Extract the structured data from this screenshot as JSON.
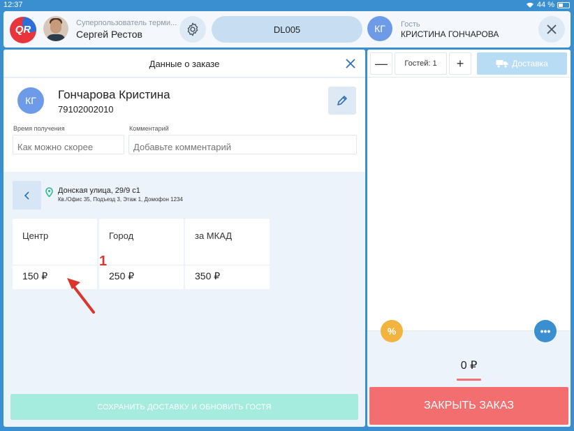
{
  "status_bar": {
    "time": "12:37",
    "battery": "44 %"
  },
  "header": {
    "logo_text": "QR",
    "user_role": "Суперпользователь терми...",
    "user_name": "Сергей Рестов",
    "order_code": "DL005",
    "guest_initials": "КГ",
    "guest_role": "Гость",
    "guest_name": "КРИСТИНА ГОНЧАРОВА"
  },
  "order_panel": {
    "title": "Данные о заказе",
    "customer": {
      "initials": "КГ",
      "name": "Гончарова Кристина",
      "phone": "79102002010"
    },
    "pickup_time": {
      "label": "Время получения",
      "placeholder": "Как можно скорее"
    },
    "comment": {
      "label": "Комментарий",
      "placeholder": "Добавьте комментарий"
    },
    "address": {
      "main": "Донская улица, 29/9 с1",
      "details": "Кв./Офис 35, Подъезд 3, Этаж 1, Домофон 1234"
    },
    "zones": [
      {
        "name": "Центр",
        "price": "150 ₽"
      },
      {
        "name": "Город",
        "price": "250 ₽"
      },
      {
        "name": "за МКАД",
        "price": "350 ₽"
      }
    ],
    "annotation_number": "1",
    "save_button": "СОХРАНИТЬ ДОСТАВКУ И ОБНОВИТЬ ГОСТЯ"
  },
  "cart_panel": {
    "guests_label": "Гостей: 1",
    "minus": "—",
    "plus": "+",
    "delivery_label": "Доставка",
    "discount_symbol": "%",
    "more_symbol": "•••",
    "total": "0 ₽",
    "close_order": "ЗАКРЫТЬ ЗАКАЗ"
  },
  "colors": {
    "primary": "#3a8fd1",
    "close_order": "#f36f6f",
    "save_button": "#a5ecde",
    "discount": "#f2b43f",
    "annotation": "#d9362e"
  }
}
